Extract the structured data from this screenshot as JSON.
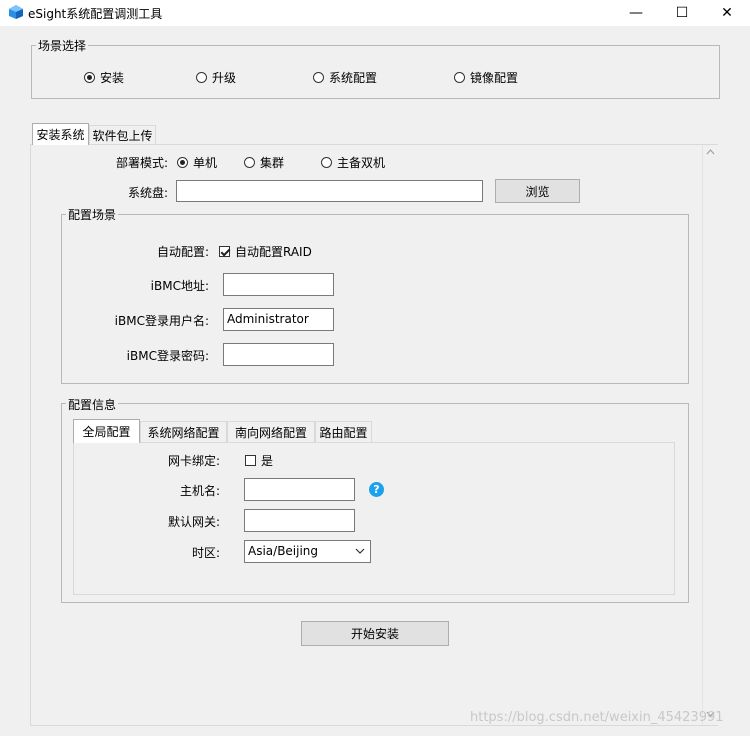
{
  "window": {
    "title": "eSight系统配置调测工具",
    "minimize": "—",
    "maximize": "☐",
    "close": "✕"
  },
  "scene": {
    "legend": "场景选择",
    "options": [
      {
        "label": "安装",
        "selected": true
      },
      {
        "label": "升级",
        "selected": false
      },
      {
        "label": "系统配置",
        "selected": false
      },
      {
        "label": "镜像配置",
        "selected": false
      }
    ]
  },
  "tabs": {
    "install": "安装系统",
    "upload": "软件包上传"
  },
  "deploy": {
    "label": "部署模式:",
    "options": [
      {
        "label": "单机",
        "selected": true
      },
      {
        "label": "集群",
        "selected": false
      },
      {
        "label": "主备双机",
        "selected": false
      }
    ]
  },
  "system_disk": {
    "label": "系统盘:",
    "value": "",
    "browse": "浏览"
  },
  "config_scene": {
    "legend": "配置场景",
    "auto_label": "自动配置:",
    "auto_raid": "自动配置RAID",
    "auto_raid_checked": true,
    "ibmc_addr_label": "iBMC地址:",
    "ibmc_addr_value": "",
    "ibmc_user_label": "iBMC登录用户名:",
    "ibmc_user_value": "Administrator",
    "ibmc_pass_label": "iBMC登录密码:",
    "ibmc_pass_value": ""
  },
  "config_info": {
    "legend": "配置信息",
    "tabs": [
      "全局配置",
      "系统网络配置",
      "南向网络配置",
      "路由配置"
    ],
    "nic_label": "网卡绑定:",
    "nic_option": "是",
    "nic_checked": false,
    "hostname_label": "主机名:",
    "hostname_value": "",
    "help_glyph": "?",
    "gateway_label": "默认网关:",
    "gateway_value": "",
    "timezone_label": "时区:",
    "timezone_value": "Asia/Beijing"
  },
  "start_button": "开始安装",
  "watermark": "https://blog.csdn.net/weixin_45423991"
}
